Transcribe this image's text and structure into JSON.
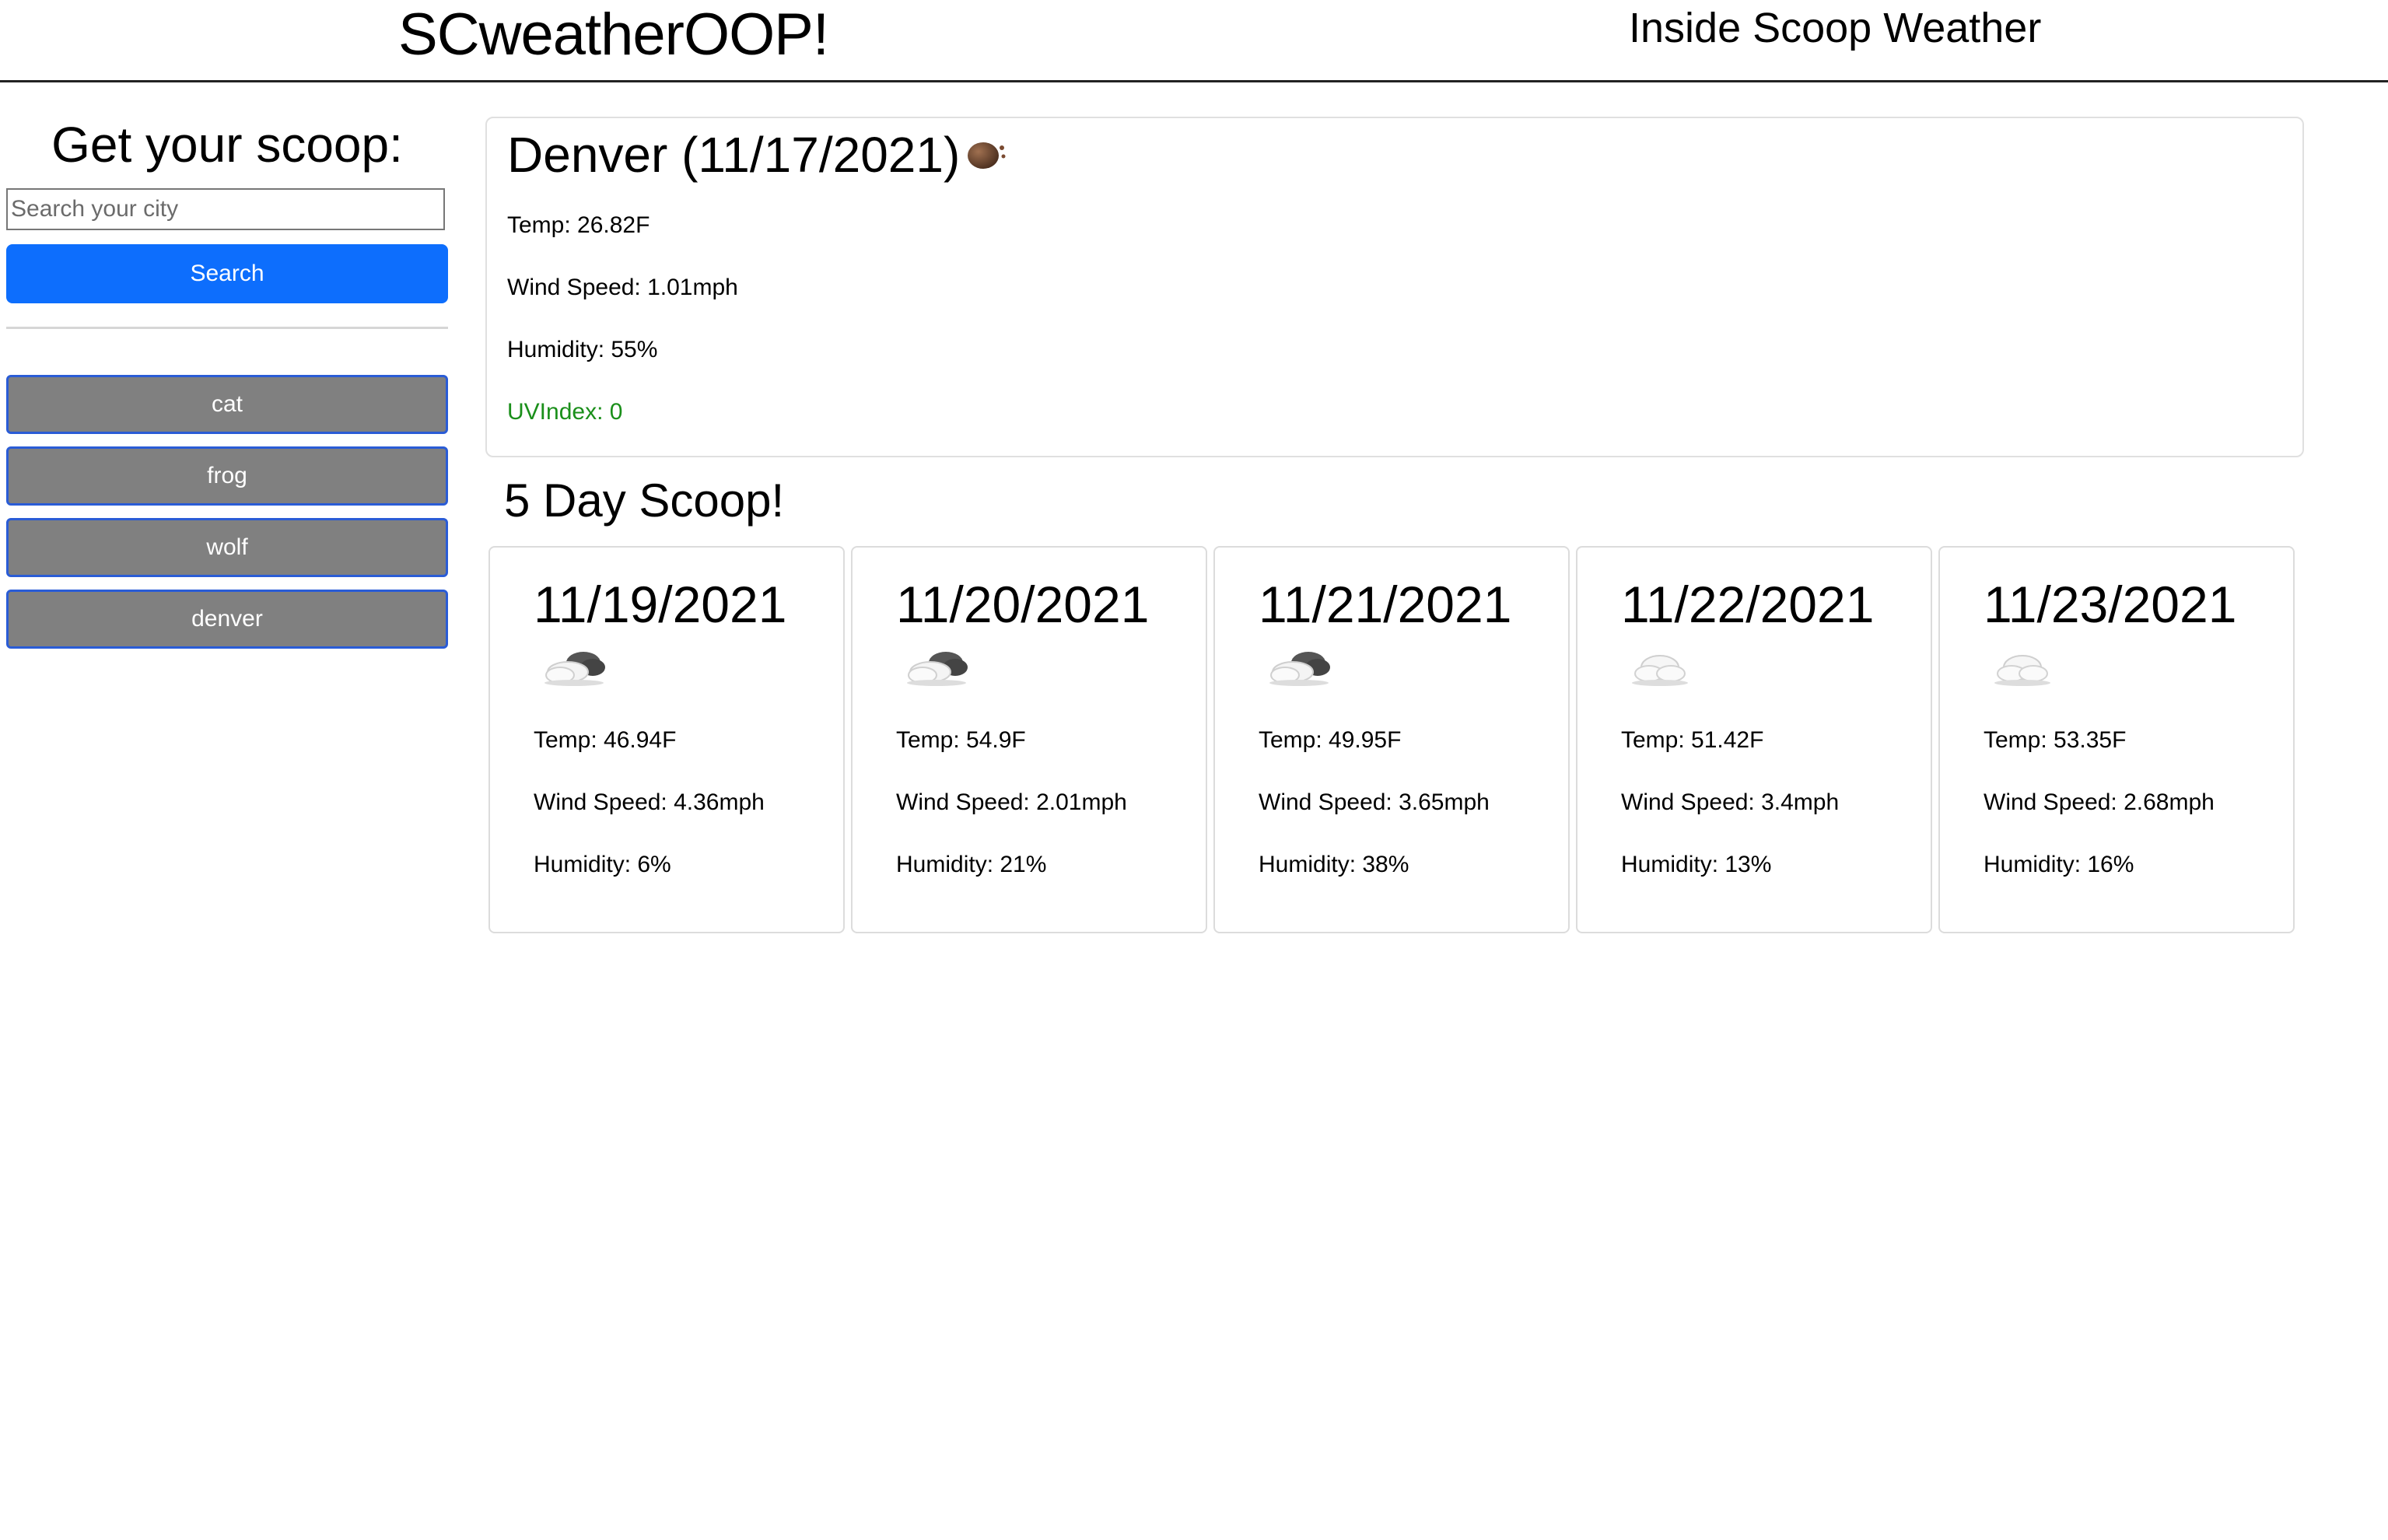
{
  "header": {
    "title": "SCweatherOOP!",
    "subtitle": "Inside Scoop Weather"
  },
  "sidebar": {
    "heading": "Get your scoop:",
    "search_placeholder": "Search your city",
    "search_value": "",
    "search_label": "Search",
    "history": [
      {
        "label": "cat"
      },
      {
        "label": "frog"
      },
      {
        "label": "wolf"
      },
      {
        "label": "denver"
      }
    ]
  },
  "current": {
    "title": "Denver (11/17/2021)",
    "icon": "moon-night-clear-icon",
    "temp": "Temp: 26.82F",
    "wind": "Wind Speed: 1.01mph",
    "humidity": "Humidity: 55%",
    "uv": "UVIndex: 0",
    "uv_color": "#1a8f1a"
  },
  "forecast": {
    "heading": "5 Day Scoop!",
    "days": [
      {
        "date": "11/19/2021",
        "icon": "broken-clouds-icon",
        "temp": "Temp: 46.94F",
        "wind": "Wind Speed: 4.36mph",
        "humidity": "Humidity: 6%"
      },
      {
        "date": "11/20/2021",
        "icon": "broken-clouds-icon",
        "temp": "Temp: 54.9F",
        "wind": "Wind Speed: 2.01mph",
        "humidity": "Humidity: 21%"
      },
      {
        "date": "11/21/2021",
        "icon": "broken-clouds-icon",
        "temp": "Temp: 49.95F",
        "wind": "Wind Speed: 3.65mph",
        "humidity": "Humidity: 38%"
      },
      {
        "date": "11/22/2021",
        "icon": "cloud-icon",
        "temp": "Temp: 51.42F",
        "wind": "Wind Speed: 3.4mph",
        "humidity": "Humidity: 13%"
      },
      {
        "date": "11/23/2021",
        "icon": "cloud-icon",
        "temp": "Temp: 53.35F",
        "wind": "Wind Speed: 2.68mph",
        "humidity": "Humidity: 16%"
      }
    ]
  },
  "colors": {
    "accent": "#0d6efd",
    "history_button": "#808080",
    "history_border": "#2a5cd6"
  }
}
